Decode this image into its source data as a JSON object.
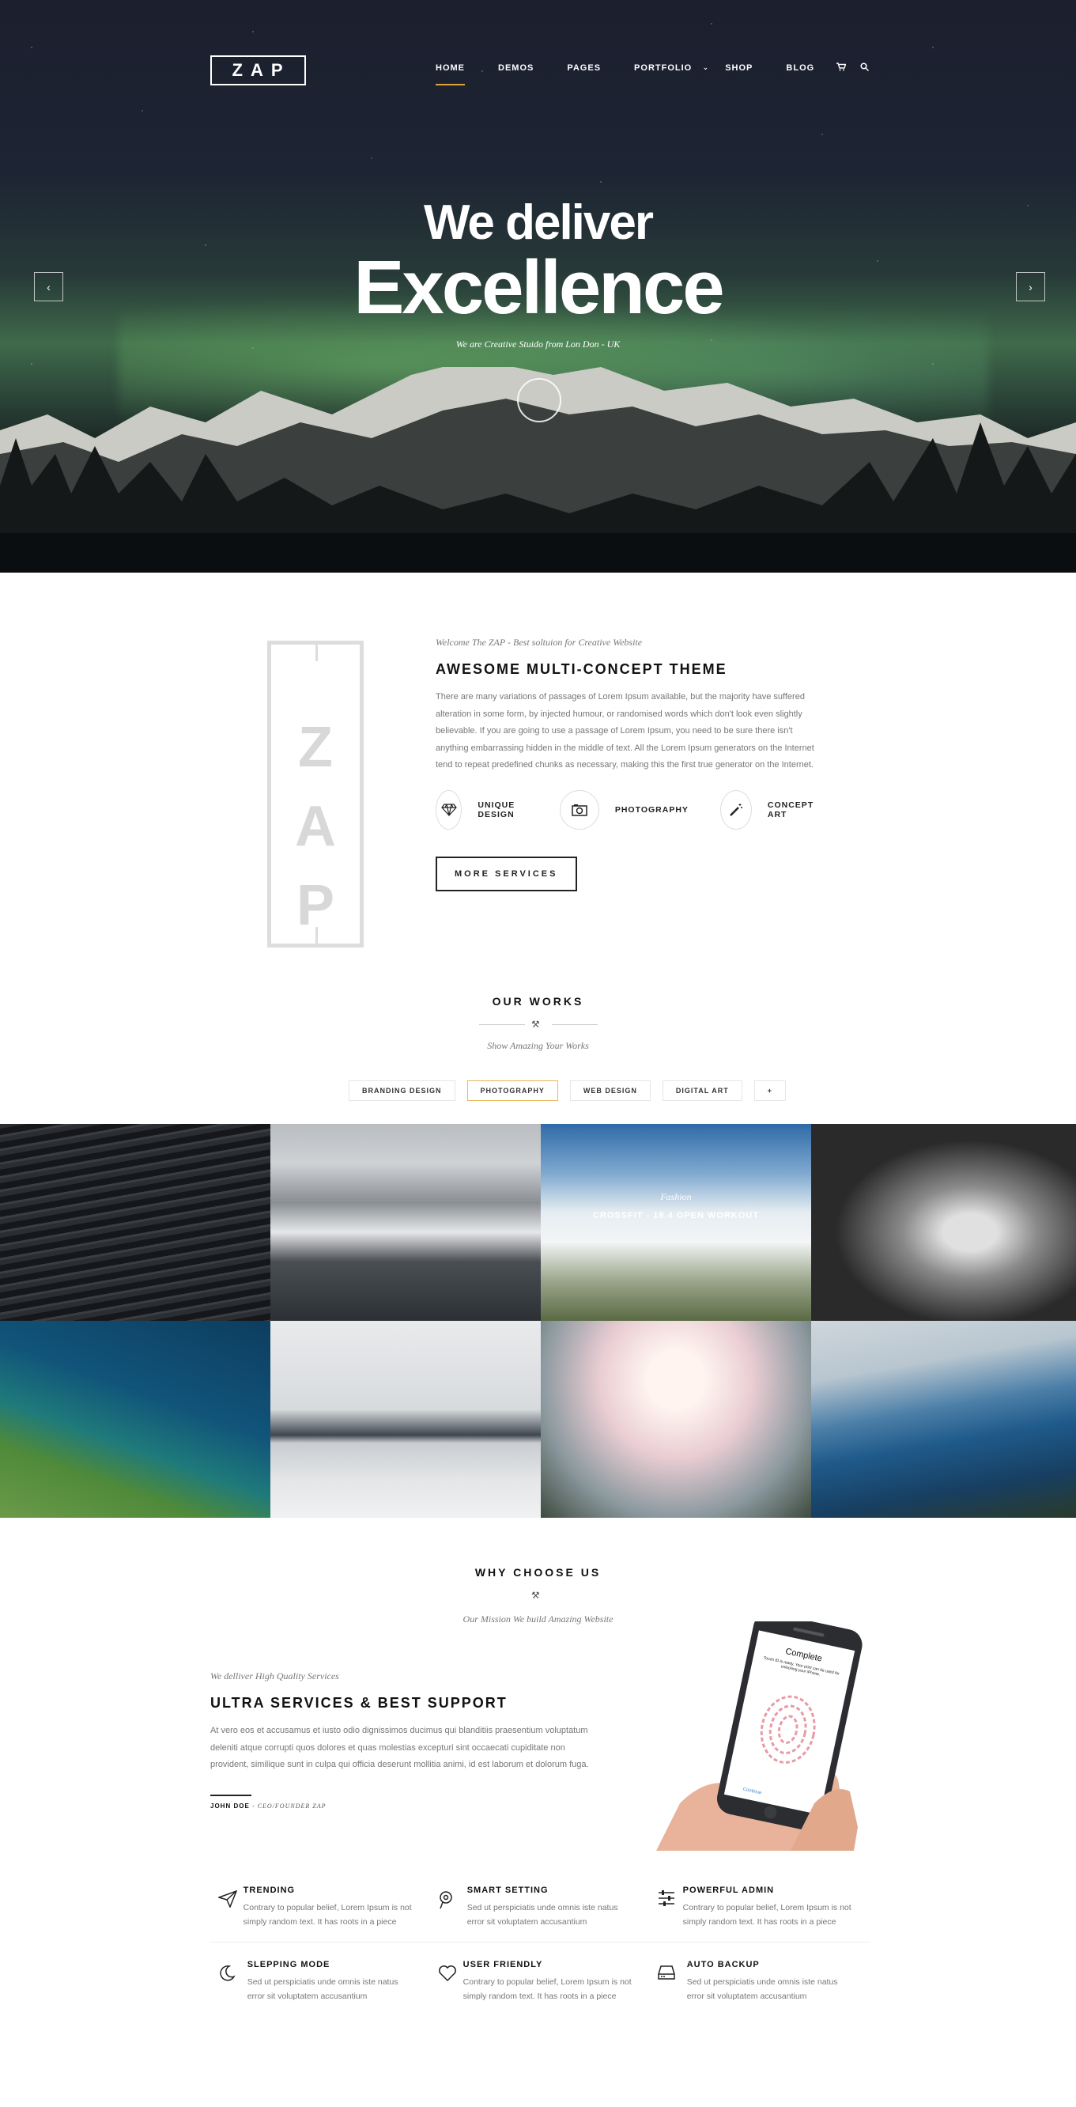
{
  "nav": {
    "logo": "ZAP",
    "items": [
      {
        "label": "HOME",
        "active": true
      },
      {
        "label": "DEMOS"
      },
      {
        "label": "PAGES"
      },
      {
        "label": "PORTFOLIO",
        "has_dropdown": true
      },
      {
        "label": "SHOP"
      },
      {
        "label": "BLOG"
      }
    ],
    "icons": [
      "cart-icon",
      "search-icon"
    ]
  },
  "hero": {
    "line1": "We deliver",
    "line2": "Excellence",
    "subtitle": "We are Creative Stuido from Lon Don - UK"
  },
  "about": {
    "vertical_logo": "ZAP",
    "script": "Welcome The ZAP - Best soltuion for Creative Website",
    "title": "AWESOME MULTI-CONCEPT THEME",
    "paragraph": "There are many variations of passages of Lorem Ipsum available, but the majority have suffered alteration in some form, by injected humour, or randomised words which don't look even slightly believable. If you are going to use a passage of Lorem Ipsum, you need to be sure there isn't anything embarrassing hidden in the middle of text. All the Lorem Ipsum generators on the Internet tend to repeat predefined chunks as necessary, making this the first true generator on the Internet.",
    "features": [
      {
        "icon": "diamond-icon",
        "label": "UNIQUE DESIGN"
      },
      {
        "icon": "camera-icon",
        "label": "PHOTOGRAPHY"
      },
      {
        "icon": "magic-wand-icon",
        "label": "CONCEPT ART"
      }
    ],
    "button": "MORE SERVICES"
  },
  "works": {
    "title": "OUR WORKS",
    "subtitle": "Show Amazing Your Works",
    "filters": [
      {
        "label": "BRANDING DESIGN"
      },
      {
        "label": "PHOTOGRAPHY",
        "active": true
      },
      {
        "label": "WEB DESIGN"
      },
      {
        "label": "DIGITAL ART"
      },
      {
        "label": "+"
      }
    ],
    "featured": {
      "category": "Fashion",
      "title": "CROSSFIT - 18.4 OPEN WORKOUT"
    }
  },
  "why": {
    "title": "WHY CHOOSE US",
    "subtitle": "Our Mission We build Amazing Website",
    "script": "We delliver High Quality Services",
    "heading": "ULTRA SERVICES & BEST SUPPORT",
    "paragraph": "At vero eos et accusamus et iusto odio dignissimos ducimus qui blanditiis praesentium voluptatum deleniti atque corrupti quos dolores et quas molestias excepturi sint occaecati cupiditate non provident, similique sunt in culpa qui officia deserunt mollitia animi, id est laborum et dolorum fuga.",
    "signature_name": "JOHN DOE",
    "signature_role": "- CEO/FOUNDER ZAP",
    "phone": {
      "title": "Complete",
      "text": "Touch ID is ready. Your print can be used for unlocking your iPhone.",
      "button": "Continue"
    }
  },
  "services": [
    {
      "icon": "paper-plane-icon",
      "title": "TRENDING",
      "text": "Contrary to popular belief, Lorem Ipsum is not simply random text. It has roots in a piece"
    },
    {
      "icon": "pin-icon",
      "title": "SMART SETTING",
      "text": "Sed ut perspiciatis unde omnis iste natus error sit voluptatem accusantium"
    },
    {
      "icon": "sliders-icon",
      "title": "POWERFUL ADMIN",
      "text": "Contrary to popular belief, Lorem Ipsum is not simply random text. It has roots in a piece"
    },
    {
      "icon": "moon-icon",
      "title": "SLEPPING MODE",
      "text": "Sed ut perspiciatis unde omnis iste natus error sit voluptatem accusantium"
    },
    {
      "icon": "heart-icon",
      "title": "USER FRIENDLY",
      "text": "Contrary to popular belief, Lorem Ipsum is not simply random text. It has roots in a piece"
    },
    {
      "icon": "hard-drive-icon",
      "title": "AUTO BACKUP",
      "text": "Sed ut perspiciatis unde omnis iste natus error sit voluptatem accusantium"
    }
  ],
  "colors": {
    "accent": "#d9a441",
    "dark": "#111111",
    "muted": "#777777"
  }
}
